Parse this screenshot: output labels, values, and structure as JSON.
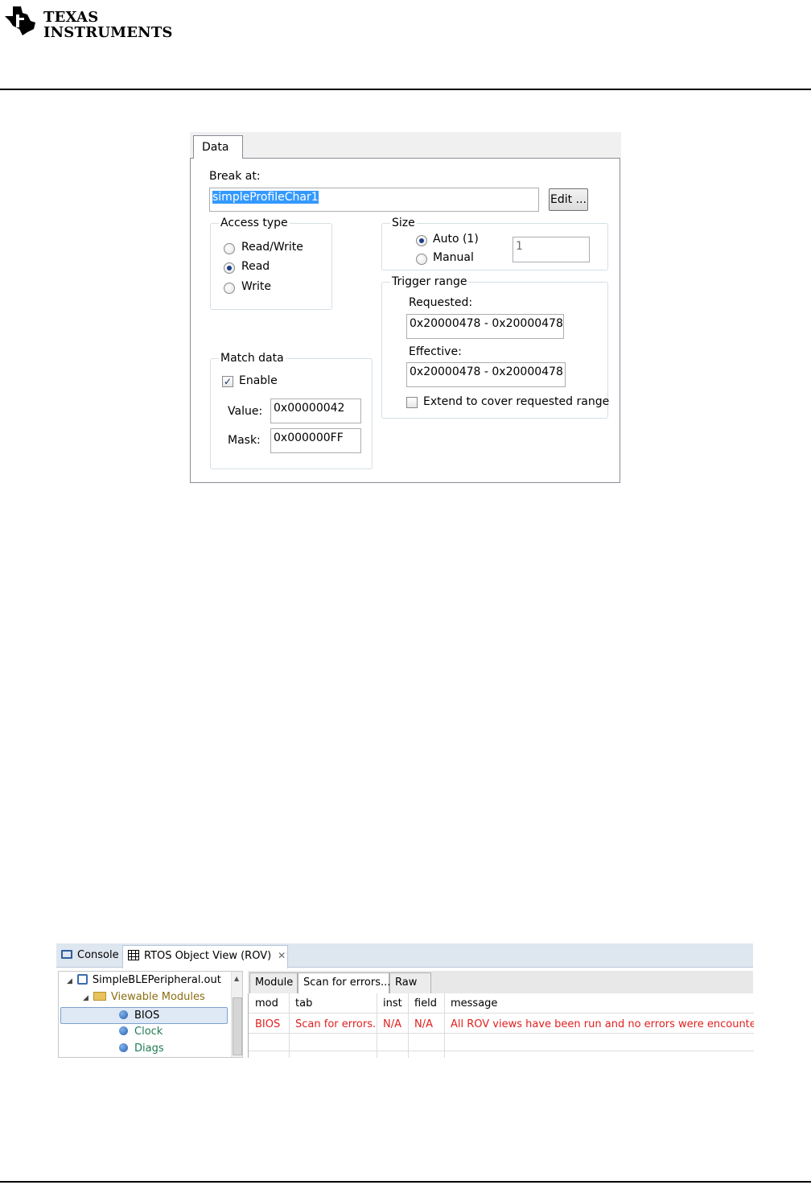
{
  "header": {
    "brand_line1": "Texas",
    "brand_line2": "Instruments"
  },
  "data_dialog": {
    "tab_label": "Data",
    "break_at_label": "Break at:",
    "break_at_value": "simpleProfileChar1",
    "edit_button": "Edit ...",
    "access_type": {
      "title": "Access type",
      "options": [
        "Read/Write",
        "Read",
        "Write"
      ],
      "selected": "Read"
    },
    "size": {
      "title": "Size",
      "auto_label": "Auto (1)",
      "manual_label": "Manual",
      "selected": "Auto (1)",
      "value": "1"
    },
    "trigger_range": {
      "title": "Trigger range",
      "requested_label": "Requested:",
      "requested_value": "0x20000478 - 0x20000478",
      "effective_label": "Effective:",
      "effective_value": "0x20000478 - 0x20000478",
      "extend_label": "Extend to cover requested range",
      "extend_checked": false
    },
    "match_data": {
      "title": "Match data",
      "enable_label": "Enable",
      "enable_checked": true,
      "value_label": "Value:",
      "value": "0x00000042",
      "mask_label": "Mask:",
      "mask": "0x000000FF"
    }
  },
  "rov_panel": {
    "view_tabs": {
      "console": "Console",
      "rov": "RTOS Object View (ROV)"
    },
    "tree": {
      "root": "SimpleBLEPeripheral.out",
      "folder": "Viewable Modules",
      "items": [
        "BIOS",
        "Clock",
        "Diags"
      ],
      "selected": "BIOS"
    },
    "inner_tabs": [
      "Module",
      "Scan for errors...",
      "Raw"
    ],
    "active_inner_tab": "Scan for errors...",
    "columns": [
      "mod",
      "tab",
      "inst",
      "field",
      "message"
    ],
    "rows": [
      {
        "mod": "BIOS",
        "tab": "Scan for errors...",
        "inst": "N/A",
        "field": "N/A",
        "message": "All ROV views have been run and no errors were encountered."
      }
    ],
    "error_color": "#e02020",
    "module_color": "#1e7a52"
  }
}
